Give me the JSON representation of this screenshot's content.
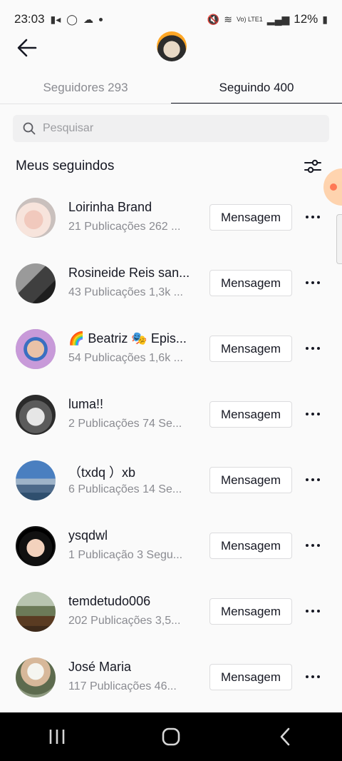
{
  "status_bar": {
    "time": "23:03",
    "battery": "12%",
    "network": "Vo) LTE1"
  },
  "header": {
    "back_icon": "arrow-left-icon",
    "avatar": "profile-avatar"
  },
  "tabs": [
    {
      "label": "Seguidores 293",
      "active": false
    },
    {
      "label": "Seguindo 400",
      "active": true
    }
  ],
  "search": {
    "placeholder": "Pesquisar",
    "icon": "search-icon"
  },
  "section": {
    "title": "Meus seguindos",
    "filter_icon": "filter-sliders-icon"
  },
  "following": [
    {
      "name": "Loirinha Brand",
      "meta": "21 Publicações   262 ...",
      "button": "Mensagem"
    },
    {
      "name": "Rosineide Reis san...",
      "meta": "43 Publicações   1,3k ...",
      "button": "Mensagem"
    },
    {
      "name": "🌈 Beatriz 🎭 Epis...",
      "meta": "54 Publicações   1,6k ...",
      "button": "Mensagem"
    },
    {
      "name": "luma!!",
      "meta": "2 Publicações   74 Se...",
      "button": "Mensagem"
    },
    {
      "name": "（txdq ）xb",
      "meta": "6 Publicações   14 Se...",
      "button": "Mensagem"
    },
    {
      "name": "ysqdwl",
      "meta": "1 Publicação   3 Segu...",
      "button": "Mensagem"
    },
    {
      "name": "temdetudo006",
      "meta": "202 Publicações   3,5...",
      "button": "Mensagem"
    },
    {
      "name": "José Maria",
      "meta": "117 Publicações   46...",
      "button": "Mensagem"
    }
  ],
  "nav_bar": {
    "recents_icon": "recents-icon",
    "home_icon": "home-icon",
    "back_icon": "back-chevron-icon"
  }
}
